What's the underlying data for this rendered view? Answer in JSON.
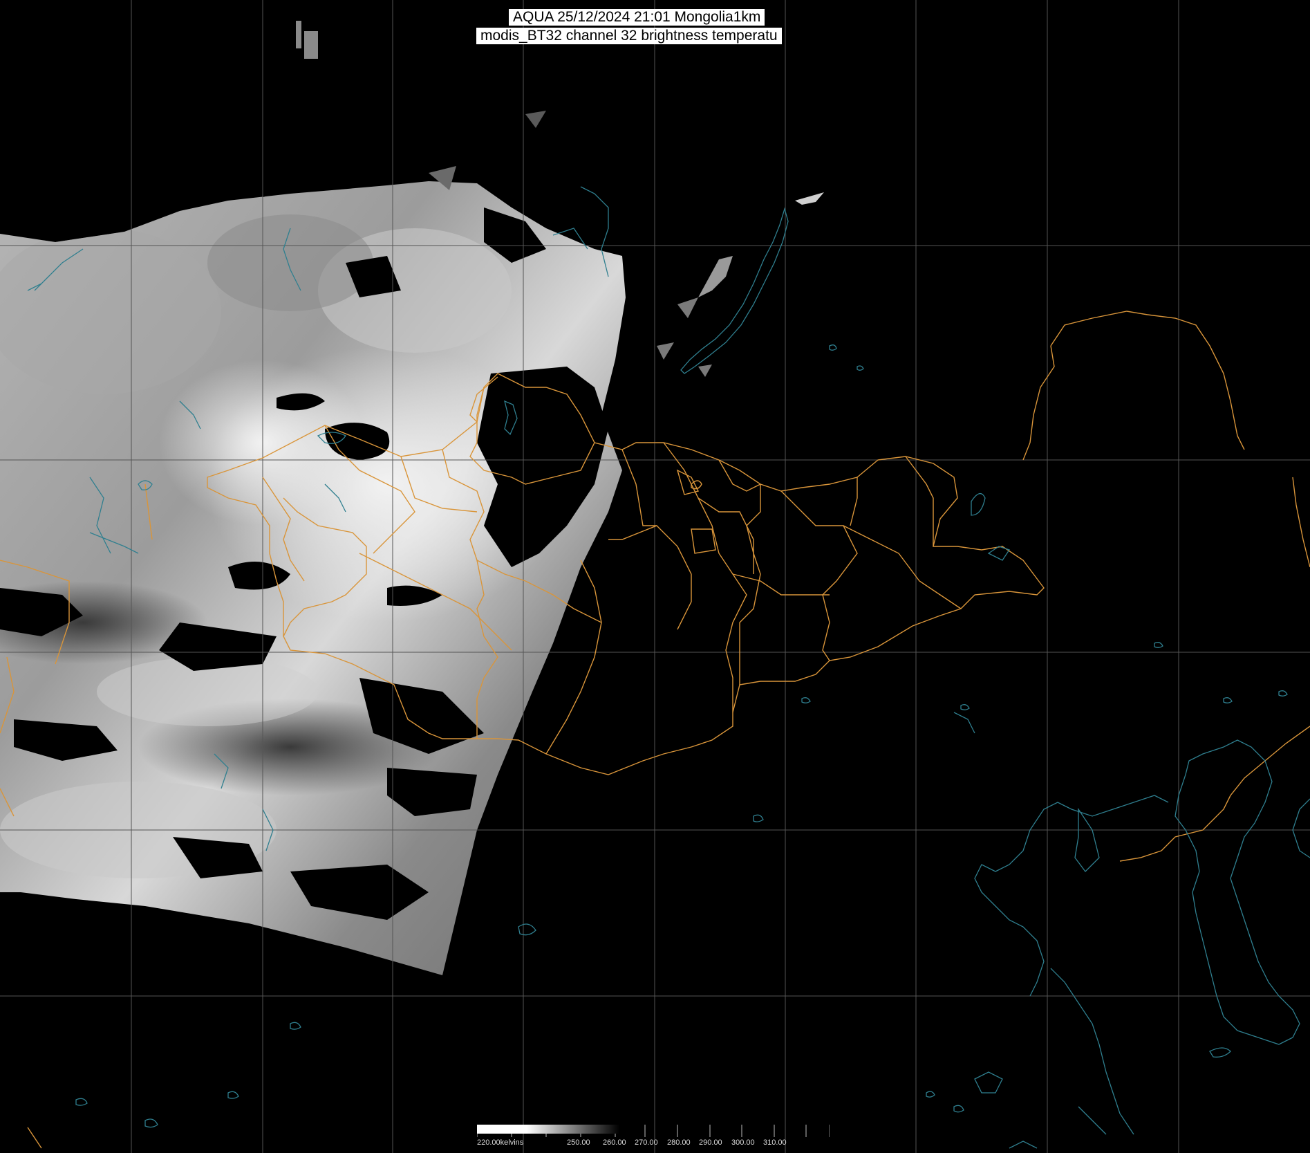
{
  "title": {
    "line1": "AQUA 25/12/2024 21:01 Mongolia1km",
    "line2": "modis_BT32 channel 32 brightness temperatu"
  },
  "colorbar": {
    "min_label": "220.00kelvins",
    "tick_labels": [
      "250.00",
      "260.00",
      "270.00",
      "280.00",
      "290.00",
      "300.00",
      "310.00"
    ]
  },
  "colors": {
    "background": "#000000",
    "grid": "#555555",
    "province_borders": "#d9953a",
    "coastlines_lakes": "#2f7f8f",
    "title_box": "#ffffff"
  },
  "layers": [
    "grid",
    "satellite-swath-grayscale",
    "cloud-masked-areas",
    "province-borders",
    "coastlines-lakes"
  ]
}
